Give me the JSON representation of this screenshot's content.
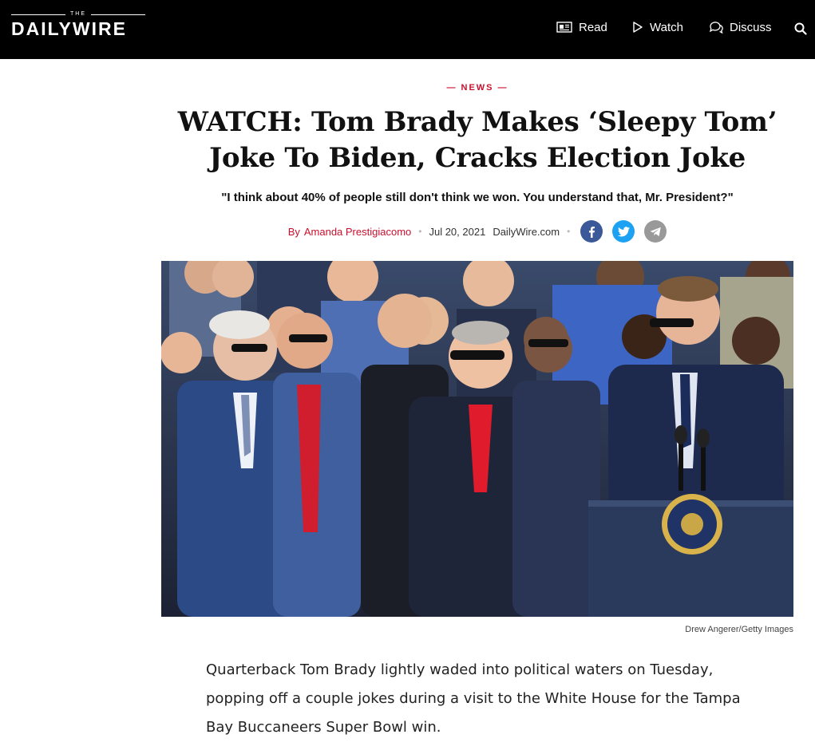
{
  "header": {
    "logo_the": "THE",
    "logo_word": "DAILYWIRE",
    "nav": {
      "read": "Read",
      "watch": "Watch",
      "discuss": "Discuss"
    }
  },
  "article": {
    "section": "— NEWS —",
    "headline": "WATCH: Tom Brady Makes ‘Sleepy Tom’ Joke To Biden, Cracks Election Joke",
    "dek": "\"I think about 40% of people still don't think we won. You understand that, Mr. President?\"",
    "byline": {
      "by": "By",
      "author": "Amanda Prestigiacomo",
      "date": "Jul 20, 2021",
      "site": "DailyWire.com"
    },
    "share_icons": [
      "facebook-icon",
      "twitter-icon",
      "telegram-icon"
    ],
    "photo_credit": "Drew Angerer/Getty Images",
    "body": "Quarterback Tom Brady lightly waded into political waters on Tuesday, popping off a couple jokes during a visit to the White House for the Tampa Bay Buccaneers Super Bowl win."
  },
  "colors": {
    "accent": "#c8102e",
    "topbar": "#000000",
    "facebook": "#3b5998",
    "twitter": "#1da1f2"
  }
}
